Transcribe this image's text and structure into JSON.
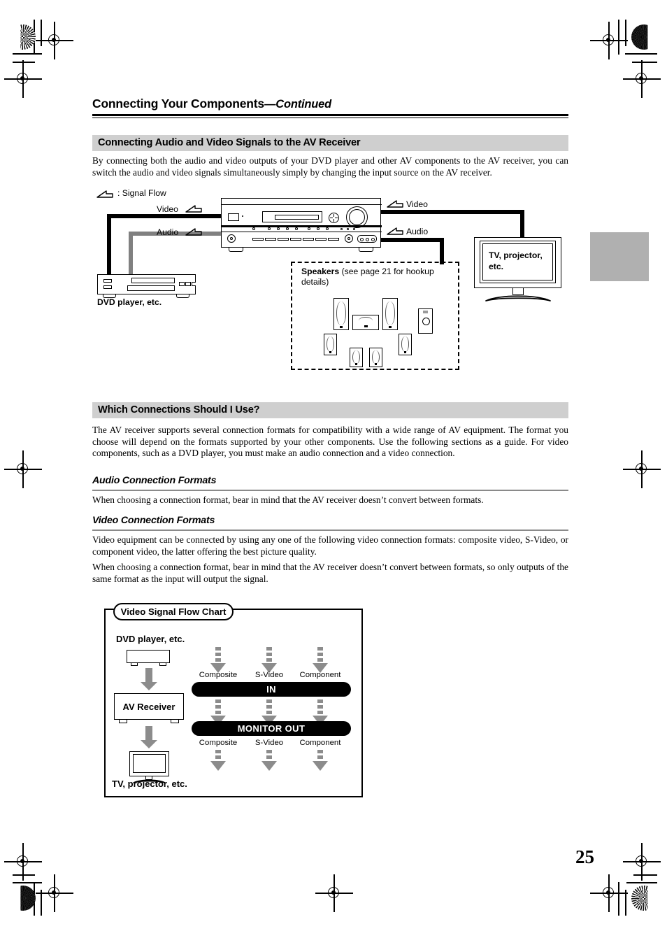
{
  "page": {
    "number": "25",
    "title_main": "Connecting Your Components",
    "title_cont": "—Continued"
  },
  "section_av": {
    "heading": "Connecting Audio and Video Signals to the AV Receiver",
    "paragraph": "By connecting both the audio and video outputs of your DVD player and other AV components to the AV receiver, you can switch the audio and video signals simultaneously simply by changing the input source on the AV receiver."
  },
  "diagram_av": {
    "legend": ": Signal Flow",
    "legend_icon": "signal-flow-arrow-icon",
    "label_video_left": "Video",
    "label_audio_left": "Audio",
    "label_video_right": "Video",
    "label_audio_right": "Audio",
    "dvd_label": "DVD player, etc.",
    "tv_label": "TV, projector,\netc.",
    "tv_label_line1": "TV, projector,",
    "tv_label_line2": "etc.",
    "speakers_title": "Speakers",
    "speakers_note_line1": " (see page 21 for hookup",
    "speakers_note_line2": "details)"
  },
  "section_which": {
    "heading": "Which Connections Should I Use?",
    "paragraph": "The AV receiver supports several connection formats for compatibility with a wide range of AV equipment. The format you choose will depend on the formats supported by your other components. Use the following sections as a guide. For video components, such as a DVD player, you must make an audio connection and a video connection.",
    "audio_sub": "Audio Connection Formats",
    "audio_text": "When choosing a connection format, bear in mind that the AV receiver doesn’t convert between formats.",
    "video_sub": "Video Connection Formats",
    "video_text_1": "Video equipment can be connected by using any one of the following video connection formats: composite video, S-Video, or component video, the latter offering the best picture quality.",
    "video_text_2": "When choosing a connection format, bear in mind that the AV receiver doesn’t convert between formats, so only outputs of the same format as the input will output the signal."
  },
  "flow_chart": {
    "badge": "Video Signal Flow Chart",
    "source_label": "DVD player, etc.",
    "receiver_label": "AV Receiver",
    "sink_label": "TV, projector, etc.",
    "in_bar": "IN",
    "out_bar": "MONITOR OUT",
    "formats_top": [
      "Composite",
      "S-Video",
      "Component"
    ],
    "formats_bottom": [
      "Composite",
      "S-Video",
      "Component"
    ]
  },
  "colors": {
    "header_gray": "#cfcfcf",
    "thumb_tab_gray": "#b0b0b0",
    "audio_wire_gray": "#808080",
    "arrow_gray": "#8c8c8c",
    "bar_black": "#000000"
  }
}
